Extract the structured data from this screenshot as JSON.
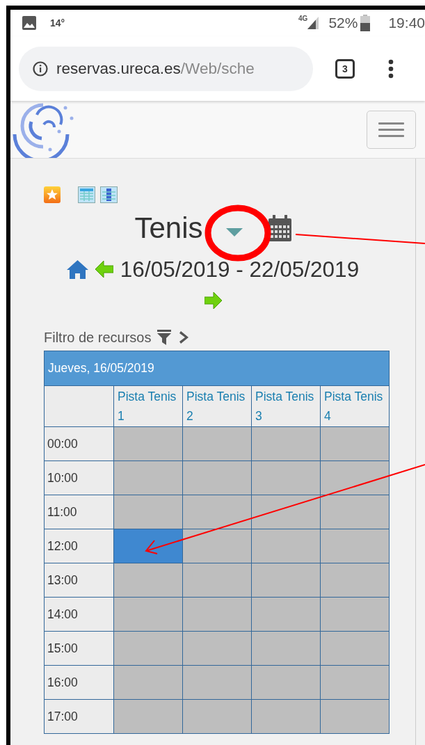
{
  "status_bar": {
    "temperature": "14°",
    "network": "4G",
    "battery": "52%",
    "time": "19:40"
  },
  "browser": {
    "url_host": "reservas.ureca.es",
    "url_path": "/Web/sche",
    "tab_count": "3"
  },
  "schedule": {
    "title": "Tenis",
    "date_range": "16/05/2019 - 22/05/2019",
    "filter_label": "Filtro de recursos",
    "day_header": "Jueves, 16/05/2019",
    "resources": [
      "Pista Tenis 1",
      "Pista Tenis 2",
      "Pista Tenis 3",
      "Pista Tenis 4"
    ],
    "rows": [
      {
        "time": "00:00",
        "slots": [
          {
            "selected": false
          },
          {
            "selected": false
          },
          {
            "selected": false
          },
          {
            "selected": false
          }
        ]
      },
      {
        "time": "10:00",
        "slots": [
          {
            "selected": false
          },
          {
            "selected": false
          },
          {
            "selected": false
          },
          {
            "selected": false
          }
        ]
      },
      {
        "time": "11:00",
        "slots": [
          {
            "selected": false
          },
          {
            "selected": false
          },
          {
            "selected": false
          },
          {
            "selected": false
          }
        ]
      },
      {
        "time": "12:00",
        "slots": [
          {
            "selected": true
          },
          {
            "selected": false
          },
          {
            "selected": false
          },
          {
            "selected": false
          }
        ]
      },
      {
        "time": "13:00",
        "slots": [
          {
            "selected": false
          },
          {
            "selected": false
          },
          {
            "selected": false
          },
          {
            "selected": false
          }
        ]
      },
      {
        "time": "14:00",
        "slots": [
          {
            "selected": false
          },
          {
            "selected": false
          },
          {
            "selected": false
          },
          {
            "selected": false
          }
        ]
      },
      {
        "time": "15:00",
        "slots": [
          {
            "selected": false
          },
          {
            "selected": false
          },
          {
            "selected": false
          },
          {
            "selected": false
          }
        ]
      },
      {
        "time": "16:00",
        "slots": [
          {
            "selected": false
          },
          {
            "selected": false
          },
          {
            "selected": false
          },
          {
            "selected": false
          }
        ]
      },
      {
        "time": "17:00",
        "slots": [
          {
            "selected": false
          },
          {
            "selected": false
          },
          {
            "selected": false
          },
          {
            "selected": false
          }
        ]
      }
    ]
  }
}
